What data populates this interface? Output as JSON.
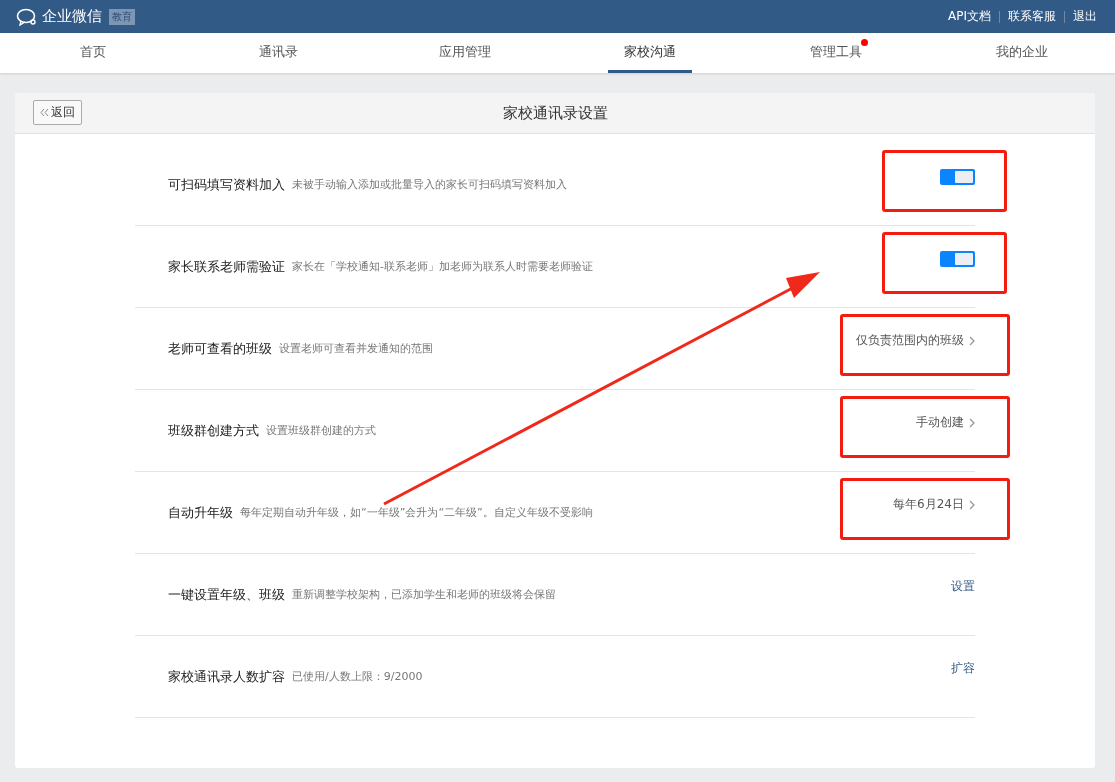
{
  "header": {
    "brand": "企业微信",
    "brand_tag": "教育",
    "links": [
      "API文档",
      "联系客服",
      "退出"
    ]
  },
  "nav": [
    {
      "label": "首页",
      "selected": false,
      "badge": false
    },
    {
      "label": "通讯录",
      "selected": false,
      "badge": false
    },
    {
      "label": "应用管理",
      "selected": false,
      "badge": false
    },
    {
      "label": "家校沟通",
      "selected": true,
      "badge": false
    },
    {
      "label": "管理工具",
      "selected": false,
      "badge": true
    },
    {
      "label": "我的企业",
      "selected": false,
      "badge": false
    }
  ],
  "panel": {
    "back": "返回",
    "title": "家校通讯录设置"
  },
  "settings": [
    {
      "kind": "toggle",
      "title": "可扫码填写资料加入",
      "description": "未被手动输入添加或批量导入的家长可扫码填写资料加入",
      "on": true,
      "highlighted": true
    },
    {
      "kind": "toggle",
      "title": "家长联系老师需验证",
      "description": "家长在「学校通知-联系老师」加老师为联系人时需要老师验证",
      "on": true,
      "highlighted": true
    },
    {
      "kind": "select",
      "title": "老师可查看的班级",
      "description": "设置老师可查看并发通知的范围",
      "value": "仅负责范围内的班级",
      "highlighted": true
    },
    {
      "kind": "select",
      "title": "班级群创建方式",
      "description": "设置班级群创建的方式",
      "value": "手动创建",
      "highlighted": true
    },
    {
      "kind": "select",
      "title": "自动升年级",
      "description": "每年定期自动升年级，如“一年级”会升为“二年级”。自定义年级不受影响",
      "value": "每年6月24日",
      "highlighted": true
    },
    {
      "kind": "link",
      "title": "一键设置年级、班级",
      "description": "重新调整学校架构，已添加学生和老师的班级将会保留",
      "value": "设置",
      "highlighted": false
    },
    {
      "kind": "link",
      "title": "家校通讯录人数扩容",
      "description": "已使用/人数上限：9/2000",
      "value": "扩容",
      "highlighted": false
    }
  ]
}
